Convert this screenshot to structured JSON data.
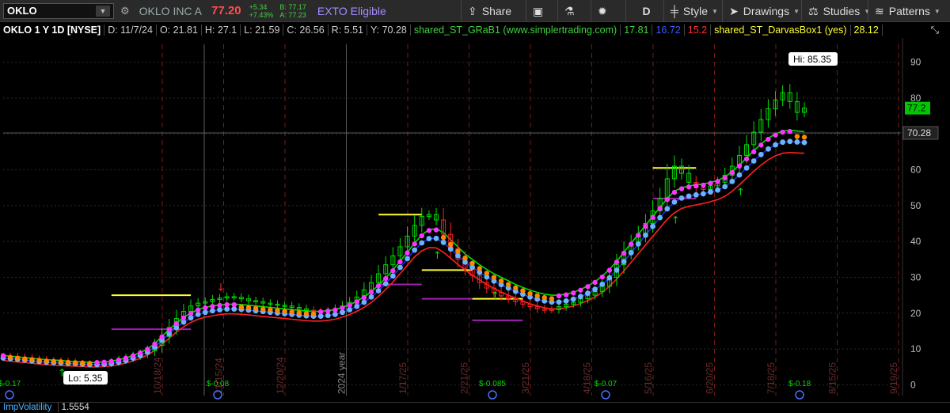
{
  "toolbar": {
    "symbol": "OKLO",
    "company": "OKLO INC A",
    "last": "77.20",
    "change_abs": "+5.34",
    "change_pct": "+7.43%",
    "bid": "B: 77.17",
    "ask": "A: 77.23",
    "exto": "EXTO Eligible",
    "buttons": {
      "share": "Share",
      "aggregation": "D",
      "style": "Style",
      "drawings": "Drawings",
      "studies": "Studies",
      "patterns": "Patterns"
    }
  },
  "infobar": {
    "title": "OKLO 1 Y 1D [NYSE]",
    "date": "D: 11/7/24",
    "open": "O: 21.81",
    "high": "H: 27.1",
    "low": "L: 21.59",
    "close": "C: 26.56",
    "range": "R: 5.51",
    "y": "Y: 70.28",
    "study1": "shared_ST_GRaB1 (www.simplertrading.com)",
    "study1_v1": "17.81",
    "study1_v2": "16.72",
    "study1_v3": "15.2",
    "study2": "shared_ST_DarvasBox1 (yes)",
    "study2_v1": "28.12"
  },
  "bottom": {
    "label": "ImpVolatility",
    "value": "1.5554"
  },
  "colors": {
    "accent_green": "#00dd00",
    "red": "#ff2020",
    "blue": "#1e32ff",
    "yellow": "#ffff33",
    "magenta": "#ff33ff",
    "orange": "#ff8800",
    "light_blue": "#6ab4ff",
    "purple": "#a020b0"
  },
  "chart_data": {
    "type": "line",
    "y_range": [
      -3,
      95
    ],
    "y_ticks": [
      "90",
      "80",
      "70",
      "60",
      "50",
      "40",
      "30",
      "20",
      "10",
      "0"
    ],
    "x_ticks": [
      "10/18/24",
      "11/15/24",
      "12/20/24",
      "2024 year",
      "1/17/25",
      "2/21/25",
      "3/21/25",
      "4/18/25",
      "5/16/25",
      "6/20/25",
      "7/18/25",
      "8/15/25",
      "9/19/25"
    ],
    "price_markers": {
      "last": "77.2",
      "crosshair": "70.28",
      "hi": "Hi: 85.35",
      "lo": "Lo: 5.35"
    },
    "dividend_labels": [
      "$-0.17",
      "$-0.08",
      "$-0.085",
      "$-0.07",
      "$-0.18"
    ],
    "series": [
      {
        "name": "price",
        "values": [
          8.0,
          7.9,
          7.7,
          7.5,
          7.2,
          7.0,
          6.8,
          6.7,
          6.5,
          6.3,
          6.0,
          5.9,
          5.8,
          5.7,
          5.9,
          6.3,
          6.8,
          7.4,
          8.0,
          8.6,
          9.5,
          11.0,
          13.5,
          16.0,
          18.5,
          20.5,
          22.0,
          22.8,
          23.2,
          23.8,
          24.2,
          24.6,
          24.4,
          24.0,
          23.5,
          23.2,
          22.8,
          22.5,
          22.2,
          22.0,
          21.6,
          21.2,
          20.8,
          20.5,
          20.3,
          20.6,
          21.2,
          22.0,
          23.0,
          24.5,
          26.5,
          28.5,
          31.0,
          33.5,
          36.0,
          38.5,
          41.5,
          44.5,
          47.0,
          47.5,
          46.0,
          42.0,
          38.0,
          35.0,
          32.5,
          30.5,
          28.5,
          27.0,
          25.8,
          24.8,
          24.0,
          23.2,
          22.5,
          21.8,
          21.2,
          20.8,
          21.0,
          21.8,
          22.5,
          23.0,
          24.0,
          25.0,
          26.0,
          27.5,
          30.0,
          33.5,
          37.0,
          39.5,
          42.0,
          45.0,
          48.5,
          52.0,
          57.5,
          61.0,
          59.0,
          56.5,
          55.0,
          54.5,
          55.5,
          56.5,
          58.5,
          61.0,
          64.0,
          67.0,
          70.5,
          74.0,
          77.0,
          79.5,
          81.5,
          79.0,
          76.0,
          77.2
        ]
      },
      {
        "name": "upper",
        "values": [
          8.2,
          8.0,
          7.8,
          7.6,
          7.4,
          7.2,
          7.0,
          6.9,
          6.8,
          6.6,
          6.5,
          6.4,
          6.3,
          6.3,
          6.4,
          6.6,
          7.0,
          7.5,
          8.2,
          9.0,
          10.0,
          11.5,
          13.5,
          15.5,
          17.2,
          18.8,
          20.0,
          21.0,
          21.6,
          22.0,
          22.3,
          22.5,
          22.5,
          22.4,
          22.2,
          22.0,
          21.8,
          21.6,
          21.4,
          21.2,
          21.0,
          20.8,
          20.6,
          20.5,
          20.5,
          20.7,
          21.0,
          21.6,
          22.3,
          23.3,
          24.5,
          26.0,
          27.8,
          29.8,
          32.0,
          34.5,
          37.0,
          39.5,
          41.8,
          43.3,
          43.5,
          42.5,
          40.5,
          38.5,
          36.5,
          35.0,
          33.5,
          32.2,
          31.0,
          30.0,
          29.0,
          28.0,
          27.2,
          26.4,
          25.8,
          25.3,
          25.0,
          25.0,
          25.3,
          25.8,
          26.6,
          27.6,
          28.8,
          30.3,
          32.2,
          34.5,
          37.0,
          39.5,
          42.0,
          44.5,
          47.0,
          49.5,
          52.0,
          54.0,
          55.0,
          55.5,
          55.8,
          56.0,
          56.5,
          57.0,
          58.0,
          59.5,
          61.3,
          63.3,
          65.3,
          67.2,
          68.8,
          70.0,
          70.8,
          71.0,
          70.8,
          70.6
        ]
      },
      {
        "name": "lower",
        "values": [
          6.8,
          6.6,
          6.4,
          6.2,
          6.0,
          5.8,
          5.6,
          5.5,
          5.4,
          5.3,
          5.2,
          5.1,
          5.0,
          5.0,
          5.1,
          5.3,
          5.6,
          6.1,
          6.7,
          7.4,
          8.3,
          9.6,
          11.3,
          13.0,
          14.7,
          16.2,
          17.4,
          18.3,
          18.9,
          19.3,
          19.6,
          19.8,
          19.8,
          19.7,
          19.5,
          19.3,
          19.1,
          18.9,
          18.7,
          18.5,
          18.3,
          18.1,
          17.9,
          17.8,
          17.8,
          18.0,
          18.3,
          18.9,
          19.6,
          20.5,
          21.6,
          23.0,
          24.7,
          26.6,
          28.7,
          31.0,
          33.4,
          35.7,
          37.4,
          38.3,
          38.2,
          37.0,
          35.3,
          33.6,
          32.0,
          30.6,
          29.3,
          28.0,
          26.9,
          25.9,
          25.0,
          24.2,
          23.4,
          22.6,
          22.0,
          21.5,
          21.2,
          21.2,
          21.5,
          22.0,
          22.7,
          23.5,
          24.5,
          25.8,
          27.5,
          29.5,
          31.8,
          34.2,
          36.6,
          39.0,
          41.4,
          43.8,
          46.2,
          48.0,
          49.2,
          49.8,
          50.2,
          50.6,
          51.1,
          51.7,
          52.6,
          54.0,
          55.8,
          57.7,
          59.6,
          61.3,
          62.8,
          63.9,
          64.6,
          64.8,
          64.7,
          64.6
        ]
      }
    ]
  }
}
